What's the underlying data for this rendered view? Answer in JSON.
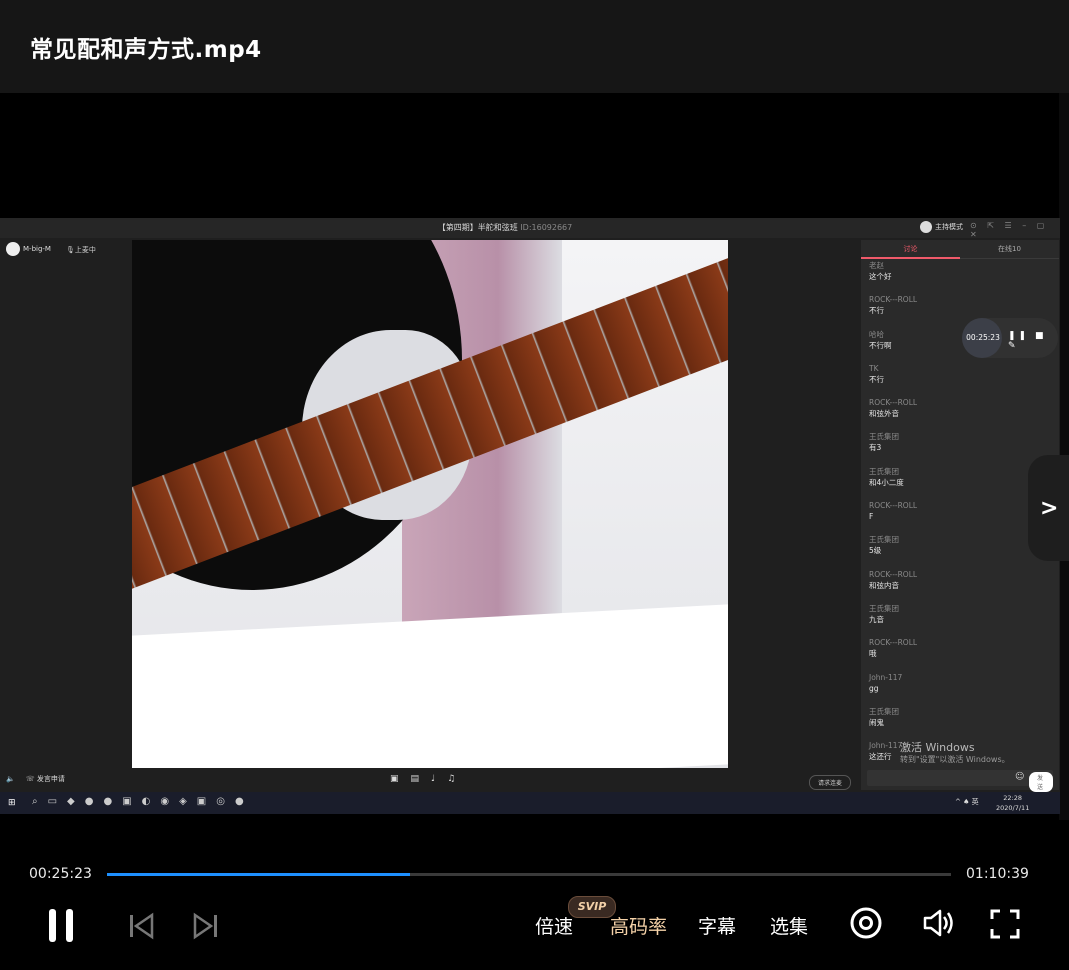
{
  "header": {
    "title": "常见配和声方式.mp4"
  },
  "stream": {
    "room_title": "【第四期】半舵和弦班",
    "room_id": "ID:16092667",
    "host_mode": "主持模式",
    "user_name": "M-big-M",
    "upper_tag": "上麦中",
    "chat_tabs": [
      "讨论",
      "在线10"
    ],
    "messages": [
      {
        "name": "老赵",
        "text": "这个好"
      },
      {
        "name": "ROCK---ROLL",
        "text": "不行"
      },
      {
        "name": "哈哈",
        "text": "不行啊"
      },
      {
        "name": "TK",
        "text": "不行"
      },
      {
        "name": "ROCK---ROLL",
        "text": "和弦外音"
      },
      {
        "name": "王氏集团",
        "text": "有3"
      },
      {
        "name": "王氏集团",
        "text": "和4小二度"
      },
      {
        "name": "ROCK---ROLL",
        "text": "F"
      },
      {
        "name": "王氏集团",
        "text": "5级"
      },
      {
        "name": "ROCK---ROLL",
        "text": "和弦内音"
      },
      {
        "name": "王氏集团",
        "text": "九音"
      },
      {
        "name": "ROCK---ROLL",
        "text": "哦"
      },
      {
        "name": "John-117",
        "text": "gg"
      },
      {
        "name": "王氏集团",
        "text": "闹鬼"
      },
      {
        "name": "John-117",
        "text": "这还行"
      }
    ],
    "send_label": "发送",
    "rec_time": "00:25:23",
    "apply_mic": "发言申请",
    "request_btn": "请求连麦",
    "watermark_line1": "激活 Windows",
    "watermark_line2": "转到\"设置\"以激活 Windows。",
    "tray_ime": "英",
    "clock_time": "22:28",
    "clock_date": "2020/7/11"
  },
  "player": {
    "current_time": "00:25:23",
    "total_time": "01:10:39",
    "progress": 0.359,
    "svip_badge": "SVIP",
    "speed_label": "倍速",
    "hq_label": "高码率",
    "subtitle_label": "字幕",
    "episodes_label": "选集",
    "accent": "#1e90ff",
    "icons": [
      "pause-icon",
      "prev-icon",
      "next-icon",
      "settings-icon",
      "volume-icon",
      "fullscreen-icon"
    ]
  }
}
